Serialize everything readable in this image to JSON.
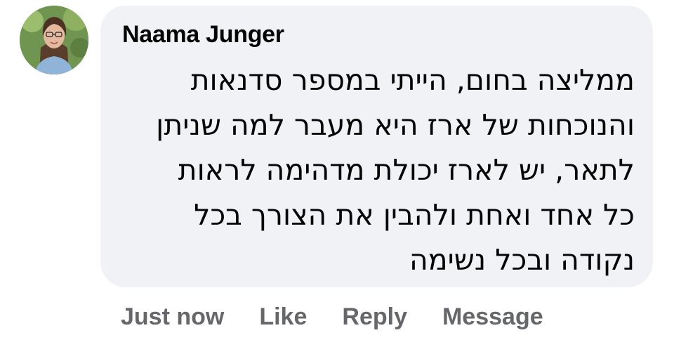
{
  "comment": {
    "author": "Naama Junger",
    "avatar_icon": "profile-photo",
    "text_lines": [
      "ממליצה בחום, הייתי במספר סדנאות",
      "והנוכחות של ארז היא מעבר למה שניתן",
      "לתאר, יש לארז יכולת מדהימה לראות",
      "כל אחד ואחת ולהבין את הצורך בכל",
      "נקודה ובכל נשימה"
    ],
    "bubble_color": "#f0f2f5"
  },
  "actions": {
    "timestamp": "Just now",
    "like_label": "Like",
    "reply_label": "Reply",
    "message_label": "Message",
    "color": "#65676b"
  }
}
